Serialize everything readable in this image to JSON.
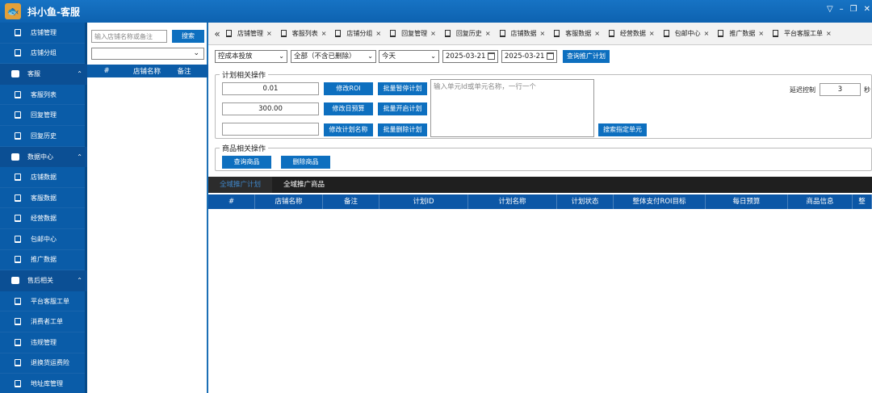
{
  "app": {
    "title": "抖小鱼-客服"
  },
  "sidebar": {
    "items": [
      {
        "type": "sub",
        "label": "店铺管理",
        "icon": "bookmark-icon"
      },
      {
        "type": "sub",
        "label": "店铺分组",
        "icon": "bookmark-icon"
      },
      {
        "type": "group",
        "label": "客服",
        "icon": "user-icon"
      },
      {
        "type": "sub",
        "label": "客服列表",
        "icon": "bookmark-icon"
      },
      {
        "type": "sub",
        "label": "回复管理",
        "icon": "bookmark-icon"
      },
      {
        "type": "sub",
        "label": "回复历史",
        "icon": "bookmark-icon"
      },
      {
        "type": "group",
        "label": "数据中心",
        "icon": "database-icon"
      },
      {
        "type": "sub",
        "label": "店铺数据",
        "icon": "bookmark-icon"
      },
      {
        "type": "sub",
        "label": "客服数据",
        "icon": "bookmark-icon"
      },
      {
        "type": "sub",
        "label": "经营数据",
        "icon": "bookmark-icon"
      },
      {
        "type": "sub",
        "label": "包邮中心",
        "icon": "bookmark-icon"
      },
      {
        "type": "sub",
        "label": "推广数据",
        "icon": "bookmark-icon"
      },
      {
        "type": "group",
        "label": "售后相关",
        "icon": "book-icon"
      },
      {
        "type": "sub",
        "label": "平台客服工单",
        "icon": "bookmark-icon"
      },
      {
        "type": "sub",
        "label": "消费者工单",
        "icon": "bookmark-icon"
      },
      {
        "type": "sub",
        "label": "违规管理",
        "icon": "bookmark-icon"
      },
      {
        "type": "sub",
        "label": "退换货运费险",
        "icon": "bookmark-icon"
      },
      {
        "type": "sub",
        "label": "地址库管理",
        "icon": "bookmark-icon"
      }
    ]
  },
  "store_panel": {
    "search_placeholder": "输入店铺名称或备注",
    "search_button": "搜索",
    "columns": [
      "#",
      "店铺名称",
      "备注"
    ]
  },
  "tabs": [
    "店铺管理",
    "客服列表",
    "店铺分组",
    "回复管理",
    "回复历史",
    "店铺数据",
    "客服数据",
    "经营数据",
    "包邮中心",
    "推广数据",
    "平台客服工单"
  ],
  "filters": {
    "mode": "控成本投放",
    "status": "全部（不含已删除）",
    "period": "今天",
    "date_start": "2025-03-21",
    "date_end": "2025-03-21",
    "query_button": "查询推广计划"
  },
  "plan_ops": {
    "legend": "计划相关操作",
    "roi_value": "0.01",
    "budget_value": "300.00",
    "name_value": "",
    "btn_modify_roi": "修改ROI",
    "btn_modify_budget": "修改日预算",
    "btn_modify_name": "修改计划名称",
    "btn_pause": "批量暂停计划",
    "btn_start": "批量开启计划",
    "btn_delete": "批量删除计划",
    "textarea_placeholder": "输入单元Id或单元名称，一行一个",
    "btn_search_unit": "搜索指定单元",
    "delay_label": "延迟控制",
    "delay_value": "3",
    "delay_unit": "秒"
  },
  "product_ops": {
    "legend": "商品相关操作",
    "btn_query": "查询商品",
    "btn_delete": "删除商品"
  },
  "grid": {
    "tabs": [
      "全域推广计划",
      "全域推广商品"
    ],
    "columns": [
      "#",
      "店铺名称",
      "备注",
      "计划ID",
      "计划名称",
      "计划状态",
      "整体支付ROI目标",
      "每日预算",
      "商品信息",
      "整"
    ]
  }
}
